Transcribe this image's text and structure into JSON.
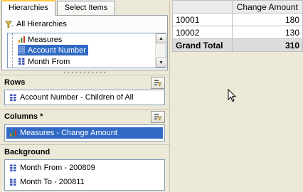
{
  "tabs": [
    {
      "label": "Hierarchies",
      "active": true
    },
    {
      "label": "Select Items",
      "active": false
    }
  ],
  "hierarchies": {
    "all_label": "All Hierarchies",
    "items": [
      {
        "label": "Measures",
        "icon": "measures-icon",
        "selected": false
      },
      {
        "label": "Account Number",
        "icon": "hierarchy-icon",
        "selected": true
      },
      {
        "label": "Month From",
        "icon": "hierarchy-icon",
        "selected": false
      }
    ]
  },
  "rows": {
    "title": "Rows",
    "items": [
      {
        "label": "Account Number - Children of All",
        "icon": "hierarchy-icon"
      }
    ]
  },
  "columns": {
    "title": "Columns *",
    "items": [
      {
        "label": "Measures - Change Amount",
        "icon": "measures-icon",
        "selected": true
      }
    ]
  },
  "background": {
    "title": "Background",
    "items": [
      {
        "label": "Month From - 200809",
        "icon": "hierarchy-icon"
      },
      {
        "label": "Month To - 200811",
        "icon": "hierarchy-icon"
      }
    ]
  },
  "pivot": {
    "column_header": "Change Amount",
    "rows": [
      {
        "label": "10001",
        "value": "180"
      },
      {
        "label": "10002",
        "value": "130"
      }
    ],
    "total": {
      "label": "Grand Total",
      "value": "310"
    }
  },
  "colors": {
    "selection": "#316ac5",
    "panel": "#ece9d8",
    "field_border": "#7f9db9"
  }
}
